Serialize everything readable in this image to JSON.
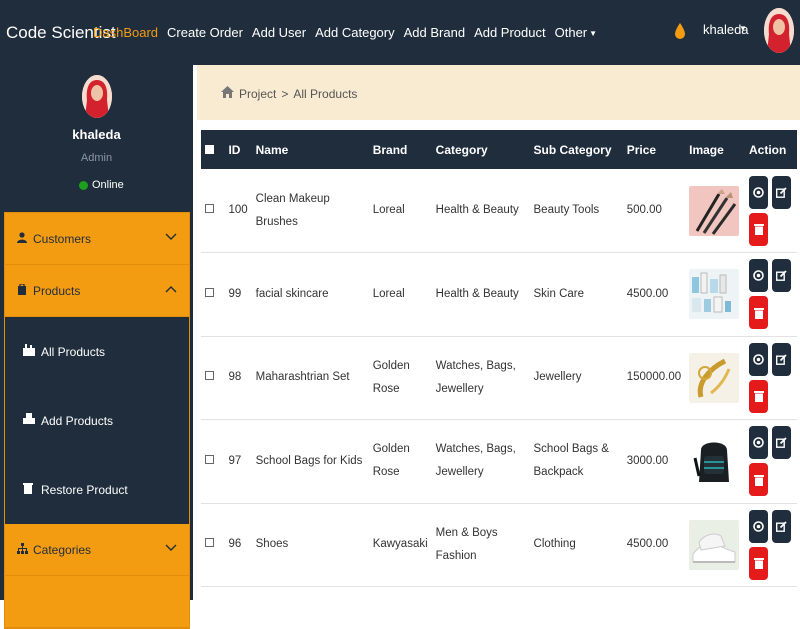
{
  "app": {
    "brand": "Code Scientist"
  },
  "topnav": {
    "items": [
      {
        "label": "DashBoard",
        "active": true
      },
      {
        "label": "Create Order"
      },
      {
        "label": "Add User"
      },
      {
        "label": "Add Category"
      },
      {
        "label": "Add Brand"
      },
      {
        "label": "Add Product"
      },
      {
        "label": "Other"
      }
    ],
    "user": {
      "name": "khaleda"
    }
  },
  "sidebar": {
    "user": {
      "name": "khaleda",
      "role": "Admin",
      "status": "Online"
    },
    "menu": {
      "customers": "Customers",
      "products": "Products",
      "all_products": "All Products",
      "add_products": "Add Products",
      "restore_product": "Restore Product",
      "categories": "Categories"
    }
  },
  "breadcrumb": {
    "root": "Project",
    "separator": ">",
    "current": "All Products"
  },
  "table": {
    "headers": {
      "id": "ID",
      "name": "Name",
      "brand": "Brand",
      "category": "Category",
      "sub_category": "Sub Category",
      "price": "Price",
      "image": "Image",
      "action": "Action"
    },
    "rows": [
      {
        "id": "100",
        "name": "Clean Makeup Brushes",
        "brand": "Loreal",
        "category": "Health & Beauty",
        "sub_category": "Beauty Tools",
        "price": "500.00"
      },
      {
        "id": "99",
        "name": "facial skincare",
        "brand": "Loreal",
        "category": "Health & Beauty",
        "sub_category": "Skin Care",
        "price": "4500.00"
      },
      {
        "id": "98",
        "name": "Maharashtrian Set",
        "brand": "Golden Rose",
        "category": "Watches, Bags, Jewellery",
        "sub_category": "Jewellery",
        "price": "150000.00"
      },
      {
        "id": "97",
        "name": "School Bags for Kids",
        "brand": "Golden Rose",
        "category": "Watches, Bags, Jewellery",
        "sub_category": "School Bags & Backpack",
        "price": "3000.00"
      },
      {
        "id": "96",
        "name": "Shoes",
        "brand": "Kawyasaki",
        "category": "Men & Boys Fashion",
        "sub_category": "Clothing",
        "price": "4500.00"
      }
    ]
  },
  "colors": {
    "navy": "#1f2d3d",
    "accent": "#f39c12",
    "danger": "#e51b1b",
    "online": "#1ea01e",
    "crumb_bg": "#f8ebd1"
  }
}
